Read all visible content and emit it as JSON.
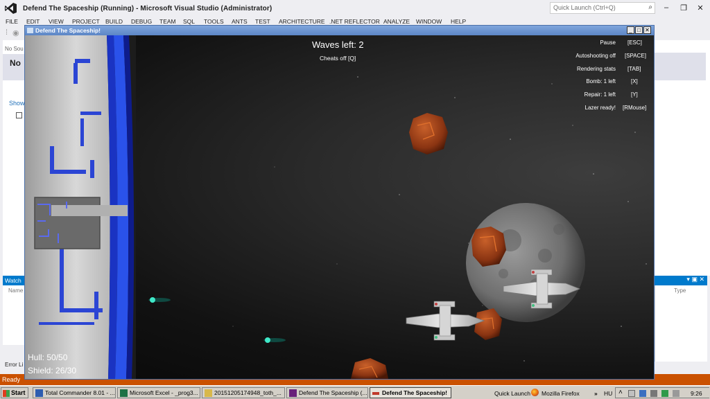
{
  "vs": {
    "title": "Defend The Spaceship (Running) - Microsoft Visual Studio (Administrator)",
    "quick_launch_placeholder": "Quick Launch (Ctrl+Q)",
    "menu": [
      "FILE",
      "EDIT",
      "VIEW",
      "PROJECT",
      "BUILD",
      "DEBUG",
      "TEAM",
      "SQL",
      "TOOLS",
      "ANTS",
      "TEST",
      "ARCHITECTURE",
      ".NET REFLECTOR",
      "ANALYZE",
      "WINDOW",
      "HELP"
    ],
    "left_panel": {
      "no_source": "No Sou",
      "heading": "No",
      "show": "Show"
    },
    "watch_label": "Watch",
    "watch_name_col": "Name",
    "watch_type_col": "Type",
    "error_list": "Error Li",
    "status": "Ready",
    "accent_color": "#007acc",
    "status_color": "#ca5100"
  },
  "game": {
    "window_title": "Defend The Spaceship!",
    "waves": "Waves left: 2",
    "cheats": "Cheats off [Q]",
    "controls": [
      {
        "label": "Pause",
        "key": "[ESC]"
      },
      {
        "label": "Autoshooting off",
        "key": "[SPACE]"
      },
      {
        "label": "Rendering stats",
        "key": "[TAB]"
      },
      {
        "label": "Bomb: 1 left",
        "key": "[X]"
      },
      {
        "label": "Repair: 1 left",
        "key": "[Y]"
      },
      {
        "label": "Lazer ready!",
        "key": "[RMouse]"
      }
    ],
    "hull": "Hull: 50/50",
    "shield": "Shield: 26/30"
  },
  "taskbar": {
    "start": "Start",
    "buttons": [
      {
        "label": "Total Commander 8.01 - ...",
        "icon": "floppy-icon"
      },
      {
        "label": "Microsoft Excel - _prog3...",
        "icon": "excel-icon"
      },
      {
        "label": "20151205174948_toth_...",
        "icon": "image-icon"
      },
      {
        "label": "Defend The Spaceship (...",
        "icon": "visual-studio-icon"
      },
      {
        "label": "Defend The Spaceship!",
        "icon": "game-icon",
        "active": true
      }
    ],
    "quick_launch": "Quick Launch",
    "firefox": "Mozilla Firefox",
    "chevrons": "»",
    "lang": "HU",
    "clock": "9:26"
  }
}
